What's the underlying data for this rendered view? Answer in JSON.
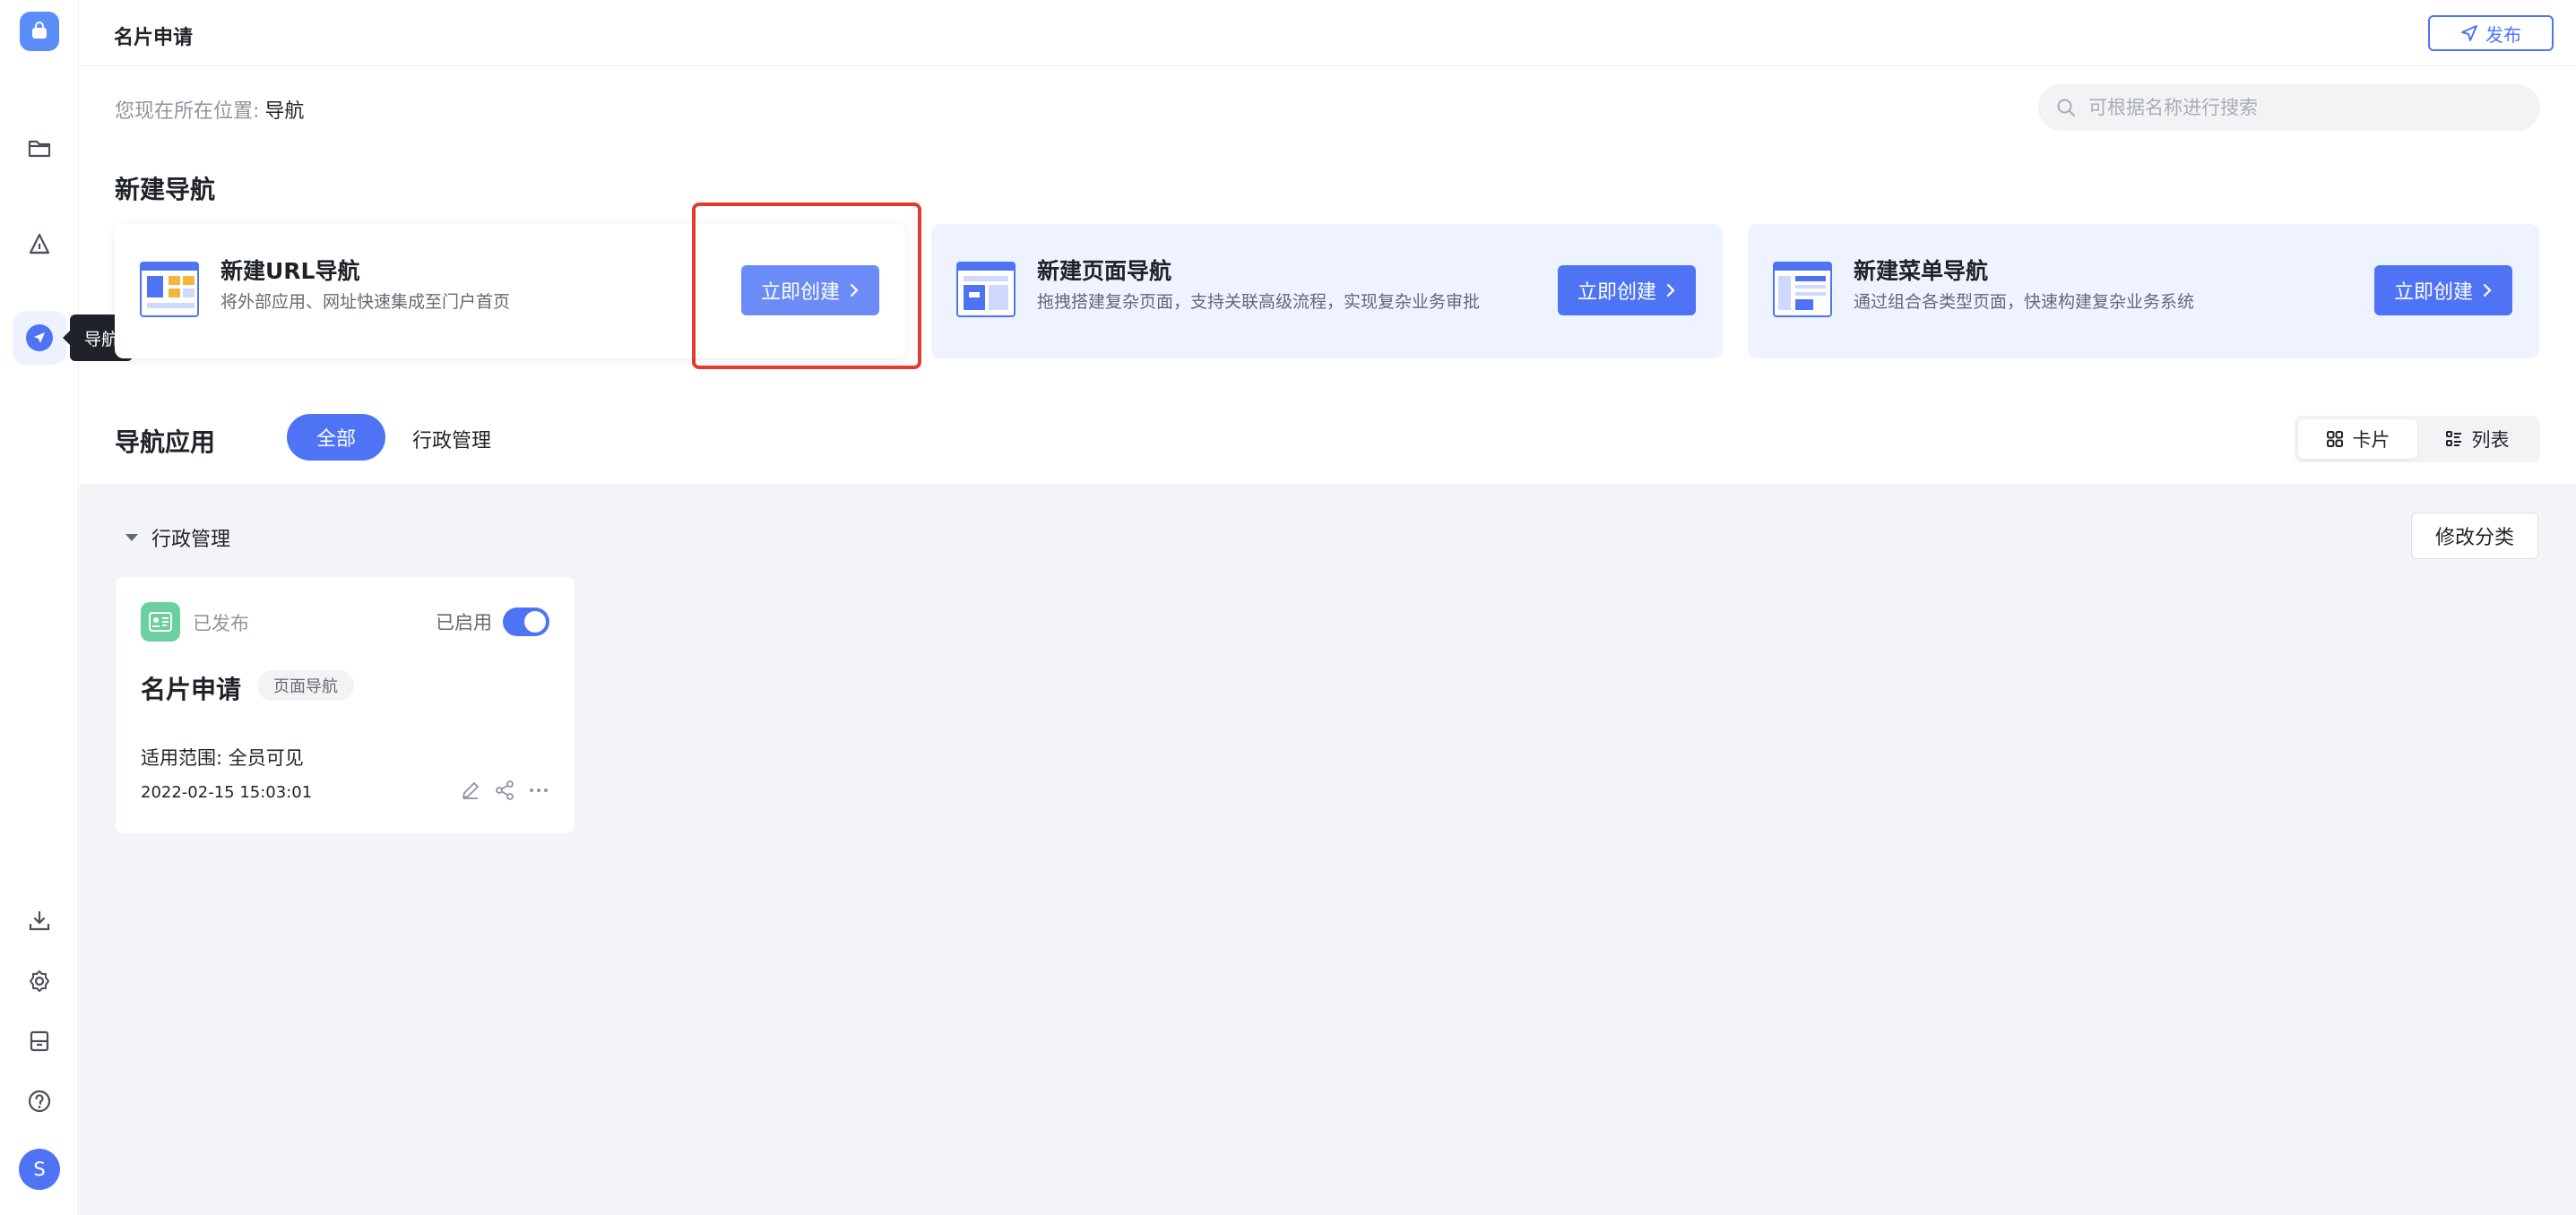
{
  "topbar": {
    "title": "名片申请",
    "publish_label": "发布"
  },
  "rail": {
    "tooltip": "导航",
    "avatar_letter": "S"
  },
  "breadcrumb": {
    "prefix": "您现在所在位置:",
    "current": "导航"
  },
  "search": {
    "placeholder": "可根据名称进行搜索"
  },
  "create_section": {
    "title": "新建导航",
    "cards": [
      {
        "title": "新建URL导航",
        "desc": "将外部应用、网址快速集成至门户首页",
        "button": "立即创建"
      },
      {
        "title": "新建页面导航",
        "desc": "拖拽搭建复杂页面，支持关联高级流程，实现复杂业务审批",
        "button": "立即创建"
      },
      {
        "title": "新建菜单导航",
        "desc": "通过组合各类型页面，快速构建复杂业务系统",
        "button": "立即创建"
      }
    ]
  },
  "apps": {
    "title": "导航应用",
    "filters": [
      "全部",
      "行政管理"
    ],
    "view_options": [
      "卡片",
      "列表"
    ],
    "group": {
      "name": "行政管理",
      "edit_label": "修改分类"
    },
    "card": {
      "status": "已发布",
      "enabled_label": "已启用",
      "name": "名片申请",
      "tag": "页面导航",
      "scope": "适用范围: 全员可见",
      "date": "2022-02-15 15:03:01"
    }
  },
  "colors": {
    "primary": "#4e74f5",
    "highlight": "#e53a2f",
    "content_bg": "#f3f4f7"
  }
}
